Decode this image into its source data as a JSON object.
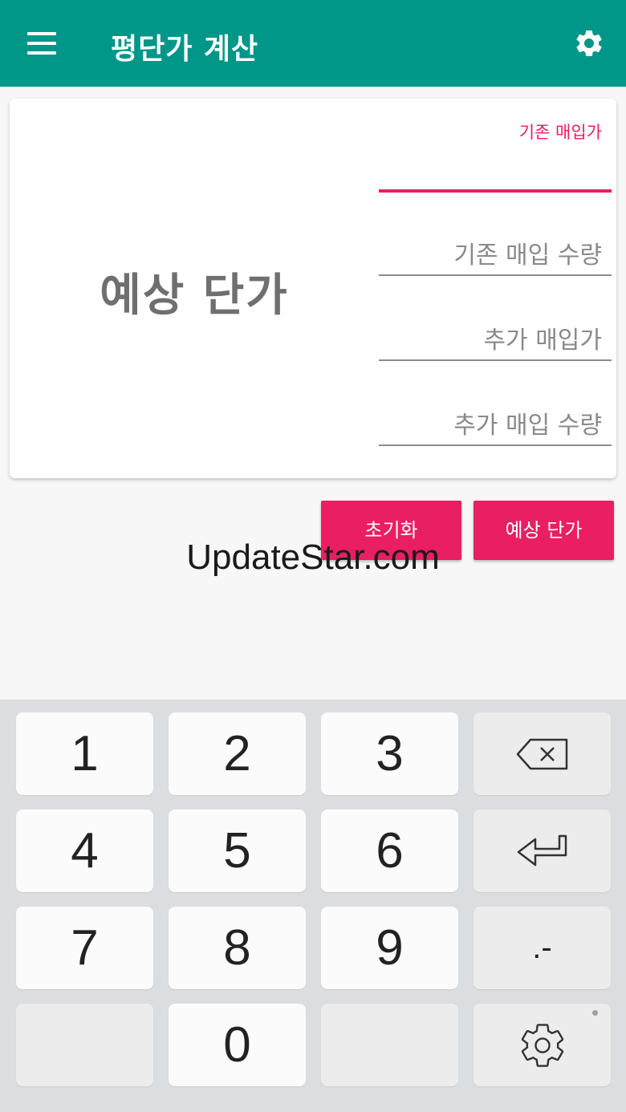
{
  "app_bar": {
    "title": "평단가 계산",
    "background": "#009688",
    "menu_icon": "hamburger-menu-icon",
    "settings_icon": "gear-icon"
  },
  "result": {
    "text": "예상 단가"
  },
  "fields": [
    {
      "label": "기존 매입가",
      "value": "",
      "focused": true
    },
    {
      "label": "기존 매입 수량",
      "value": ""
    },
    {
      "label": "추가 매입가",
      "value": ""
    },
    {
      "label": "추가 매입 수량",
      "value": ""
    }
  ],
  "buttons": {
    "reset": "초기화",
    "estimate": "예상 단가"
  },
  "accent_color": "#e91e63",
  "watermark": "UpdateStar.com",
  "keypad": {
    "rows": [
      [
        "1",
        "2",
        "3",
        "backspace"
      ],
      [
        "4",
        "5",
        "6",
        "enter"
      ],
      [
        "7",
        "8",
        "9",
        ".-"
      ],
      [
        "",
        "0",
        "",
        "settings"
      ]
    ],
    "icons": {
      "backspace": "backspace-icon",
      "enter": "enter-icon",
      "settings": "keyboard-settings-icon"
    }
  }
}
